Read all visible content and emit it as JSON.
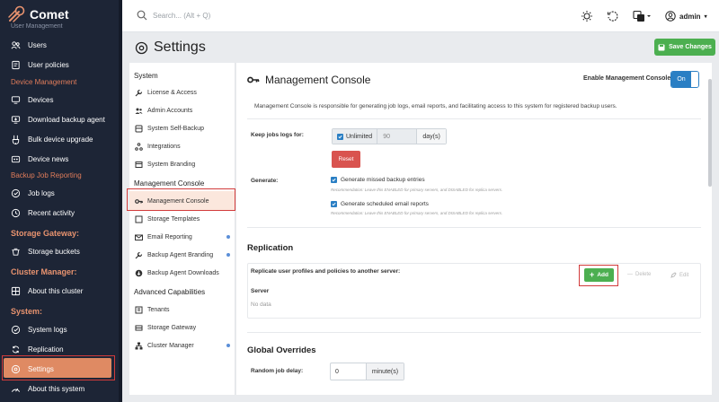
{
  "brand": {
    "name": "Comet"
  },
  "sidebar": {
    "cutoff_label": "User Management",
    "groups": [
      {
        "title": "",
        "items": [
          {
            "label": "Users",
            "icon": "users-icon"
          },
          {
            "label": "User policies",
            "icon": "policy-icon"
          }
        ]
      },
      {
        "title": "Device Management",
        "items": [
          {
            "label": "Devices",
            "icon": "device-icon"
          },
          {
            "label": "Download backup agent",
            "icon": "download-icon"
          },
          {
            "label": "Bulk device upgrade",
            "icon": "upgrade-icon"
          },
          {
            "label": "Device news",
            "icon": "news-icon"
          }
        ]
      },
      {
        "title": "Backup Job Reporting",
        "items": [
          {
            "label": "Job logs",
            "icon": "joblog-icon"
          },
          {
            "label": "Recent activity",
            "icon": "clock-icon"
          }
        ]
      },
      {
        "title": "Storage Gateway:",
        "items": [
          {
            "label": "Storage buckets",
            "icon": "bucket-icon"
          }
        ]
      },
      {
        "title": "Cluster Manager:",
        "items": [
          {
            "label": "About this cluster",
            "icon": "cluster-icon"
          }
        ]
      },
      {
        "title": "System:",
        "items": [
          {
            "label": "System logs",
            "icon": "syslog-icon"
          },
          {
            "label": "Replication",
            "icon": "replication-icon"
          },
          {
            "label": "Settings",
            "icon": "settings-icon"
          },
          {
            "label": "About this system",
            "icon": "about-icon"
          }
        ]
      }
    ]
  },
  "topbar": {
    "search_placeholder": "Search... (Alt + Q)",
    "user": "admin"
  },
  "page": {
    "title": "Settings",
    "save_label": "Save Changes"
  },
  "settings_nav": {
    "sections": [
      {
        "title": "System",
        "items": [
          "License & Access",
          "Admin Accounts",
          "System Self-Backup",
          "Integrations",
          "System Branding"
        ]
      },
      {
        "title": "Management Console",
        "items": [
          "Management Console",
          "Storage Templates",
          "Email Reporting",
          "Backup Agent Branding",
          "Backup Agent Downloads"
        ]
      },
      {
        "title": "Advanced Capabilities",
        "items": [
          "Tenants",
          "Storage Gateway",
          "Cluster Manager"
        ]
      }
    ],
    "active": "Management Console"
  },
  "management_console": {
    "title": "Management Console",
    "enable_label": "Enable Management Console:",
    "toggle_state": "On",
    "description": "Management Console is responsible for generating job logs, email reports, and facilitating access to this system for registered backup users.",
    "keep_logs_label": "Keep jobs logs for:",
    "unlimited_label": "Unlimited",
    "keep_logs_value": "90",
    "keep_logs_unit": "day(s)",
    "reset_label": "Reset",
    "generate_label": "Generate:",
    "gen_missed": "Generate missed backup entries",
    "gen_missed_hint": "Recommendation: Leave this ENABLED for primary servers, and DISABLED for replica servers.",
    "gen_email": "Generate scheduled email reports",
    "gen_email_hint": "Recommendation: Leave this ENABLED for primary servers, and DISABLED for replica servers."
  },
  "replication": {
    "title": "Replication",
    "label": "Replicate user profiles and policies to another server:",
    "add_label": "Add",
    "delete_label": "Delete",
    "edit_label": "Edit",
    "server_header": "Server",
    "empty_text": "No data"
  },
  "global_overrides": {
    "title": "Global Overrides",
    "delay_label": "Random job delay:",
    "delay_value": "0",
    "delay_unit": "minute(s)"
  },
  "colors": {
    "sidebar_bg": "#1d2536",
    "accent": "#df8a63",
    "primary": "#2a7fc4",
    "success": "#4caf50",
    "danger": "#d9534f"
  }
}
